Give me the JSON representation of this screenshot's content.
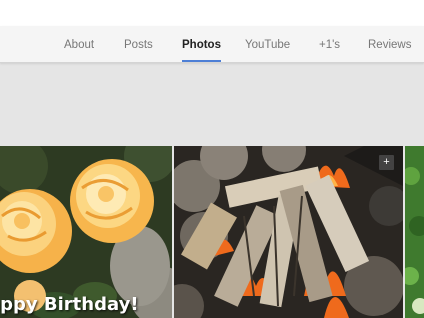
{
  "tabs": [
    {
      "label": "About"
    },
    {
      "label": "Posts"
    },
    {
      "label": "Photos"
    },
    {
      "label": "YouTube"
    },
    {
      "label": "+1's"
    },
    {
      "label": "Reviews"
    }
  ],
  "active_tab": "Photos",
  "photos": [
    {
      "caption": "appy Birthday!"
    },
    {
      "badge": "+"
    },
    {}
  ],
  "colors": {
    "active_underline": "#4d7fd6",
    "tab_text": "#777777",
    "active_tab_text": "#222222",
    "page_bg": "#e5e5e5"
  },
  "icons": {
    "photo_badge": "sparkle-plus-icon"
  }
}
